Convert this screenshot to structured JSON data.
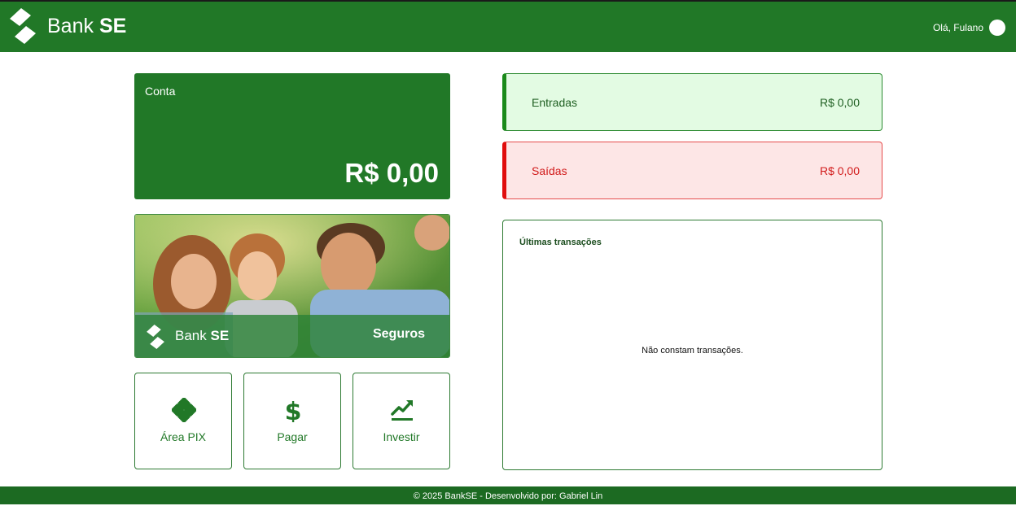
{
  "header": {
    "brand_light": "Bank",
    "brand_bold": "SE",
    "greeting": "Olá, Fulano",
    "logo_icon": "bank-se-logo-icon",
    "avatar_icon": "user-avatar-icon"
  },
  "account": {
    "label": "Conta",
    "balance": "R$ 0,00"
  },
  "banner": {
    "brand_light": "Bank",
    "brand_bold": "SE",
    "title": "Seguros"
  },
  "actions": [
    {
      "label": "Área PIX",
      "icon": "pix-icon"
    },
    {
      "label": "Pagar",
      "icon": "dollar-icon"
    },
    {
      "label": "Investir",
      "icon": "chart-up-icon"
    }
  ],
  "summary": {
    "income": {
      "label": "Entradas",
      "value": "R$ 0,00"
    },
    "expenses": {
      "label": "Saídas",
      "value": "R$ 0,00"
    }
  },
  "transactions": {
    "title": "Últimas transações",
    "empty_message": "Não constam transações."
  },
  "footer": {
    "text": "© 2025 BankSE - Desenvolvido por: Gabriel Lin"
  },
  "colors": {
    "brand_green": "#217827",
    "income_bg": "#e3fbe3",
    "expense_bg": "#fde6e6",
    "expense_red": "#e00d0d"
  }
}
